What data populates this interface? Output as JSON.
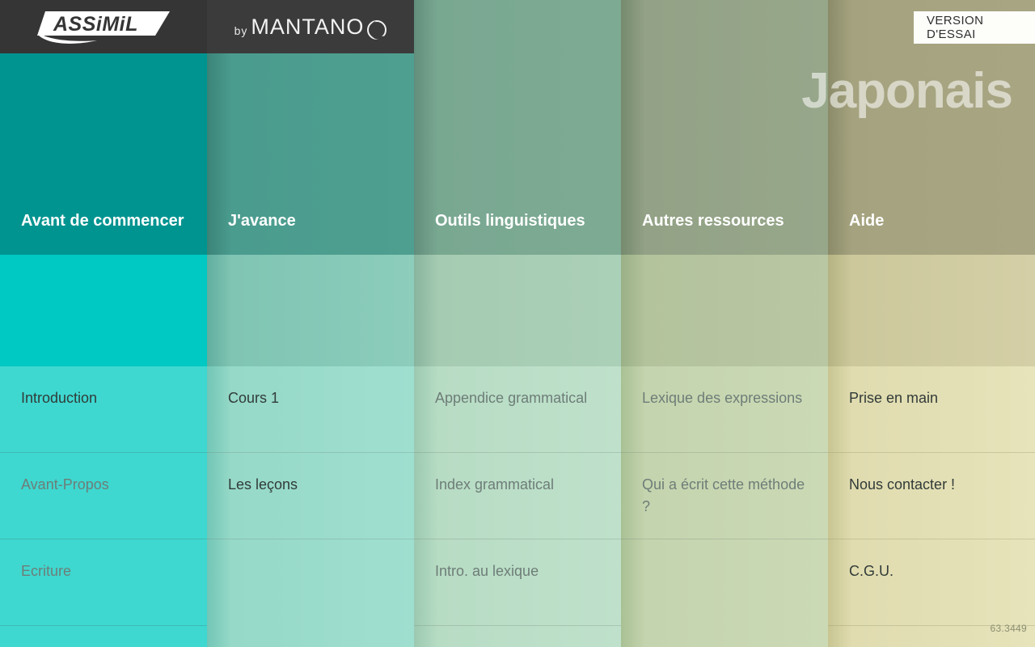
{
  "app": {
    "brand": "ASSIMIL",
    "brand_registered": "®",
    "by_label": "by",
    "publisher": "MANTANO",
    "language_title": "Japonais",
    "trial_badge": "VERSION D'ESSAI",
    "version": "63.3449"
  },
  "colors": {
    "col1": "#00bfbf",
    "col2": "#6fc9bb",
    "col3": "#93bda2",
    "col4": "#a3b291",
    "col5": "#b7b38e",
    "trial_bg": "#fdfdfa",
    "enabled_text": "#313b38",
    "disabled_text": "#6e7d78",
    "header_text": "#ffffff"
  },
  "columns": [
    {
      "id": "avant-de-commencer",
      "title": "Avant de commencer",
      "items": [
        {
          "label": "Introduction",
          "state": "enabled"
        },
        {
          "label": "Avant-Propos",
          "state": "dim"
        },
        {
          "label": "Ecriture",
          "state": "dim"
        }
      ]
    },
    {
      "id": "j-avance",
      "title": "J'avance",
      "items": [
        {
          "label": "Cours 1",
          "state": "enabled"
        },
        {
          "label": "Les leçons",
          "state": "enabled"
        },
        {
          "label": "",
          "state": "empty"
        }
      ]
    },
    {
      "id": "outils-linguistiques",
      "title": "Outils linguistiques",
      "items": [
        {
          "label": "Appendice grammatical",
          "state": "dim"
        },
        {
          "label": "Index grammatical",
          "state": "dim"
        },
        {
          "label": "Intro. au lexique",
          "state": "dim"
        }
      ]
    },
    {
      "id": "autres-ressources",
      "title": "Autres ressources",
      "items": [
        {
          "label": "Lexique des expressions",
          "state": "dim"
        },
        {
          "label": "Qui a écrit cette méthode ?",
          "state": "dim"
        },
        {
          "label": "",
          "state": "empty"
        }
      ]
    },
    {
      "id": "aide",
      "title": "Aide",
      "items": [
        {
          "label": "Prise en main",
          "state": "enabled"
        },
        {
          "label": "Nous contacter !",
          "state": "enabled"
        },
        {
          "label": "C.G.U.",
          "state": "enabled"
        }
      ]
    }
  ]
}
